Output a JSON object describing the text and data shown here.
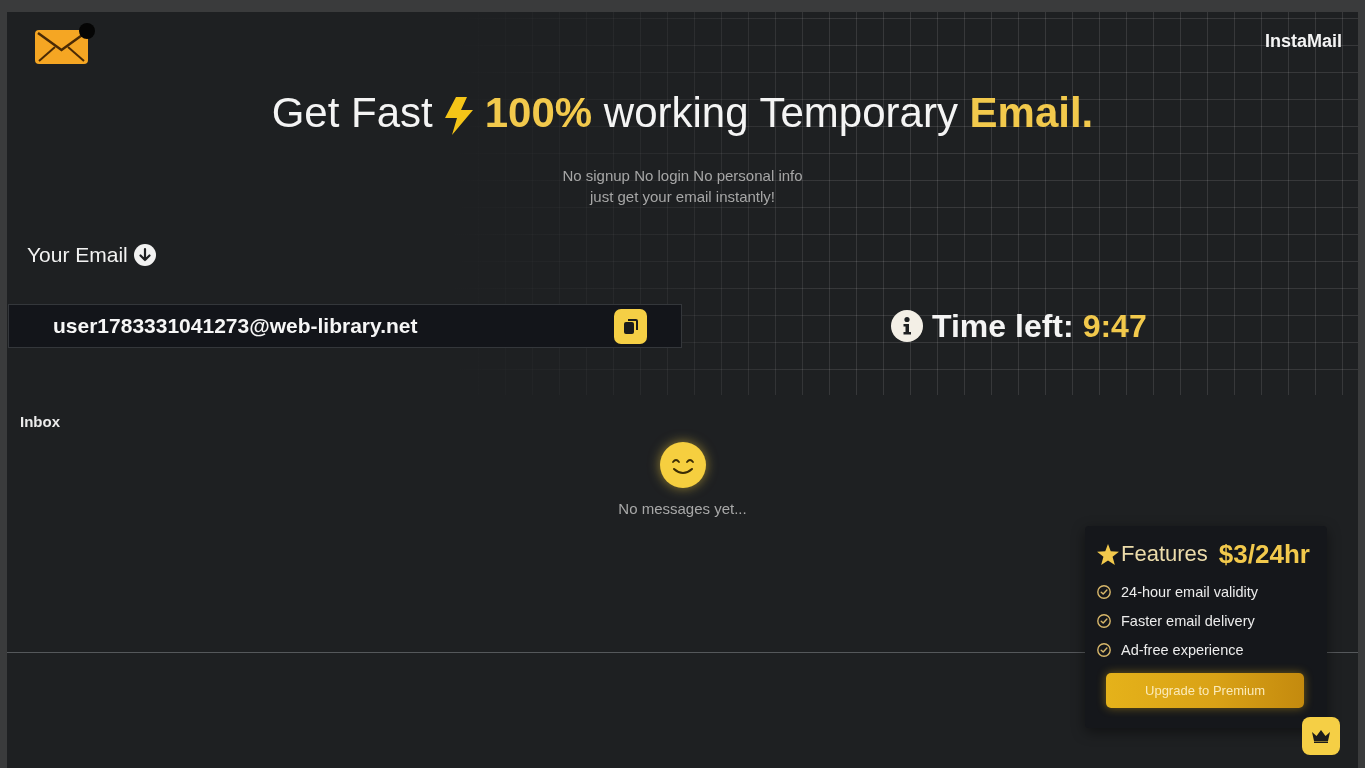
{
  "header": {
    "brand": "InstaMail"
  },
  "hero": {
    "title_lead": "Get Fast",
    "title_rest": "**100%** working Temporary **Email.**",
    "subtitle": "No signup No login No personal info\njust get your email instantly!"
  },
  "email": {
    "label": "Your Email",
    "address": "user1783331041273@web-library.net"
  },
  "timer": {
    "label": "Time left:",
    "value": "9:47"
  },
  "inbox": {
    "title": "Inbox",
    "empty_message": "No messages yet..."
  },
  "premium": {
    "title": "Features",
    "price": "$3/24hr",
    "features": [
      "24-hour email validity",
      "Faster email delivery",
      "Ad-free experience"
    ],
    "button": "Upgrade to Premium"
  }
}
